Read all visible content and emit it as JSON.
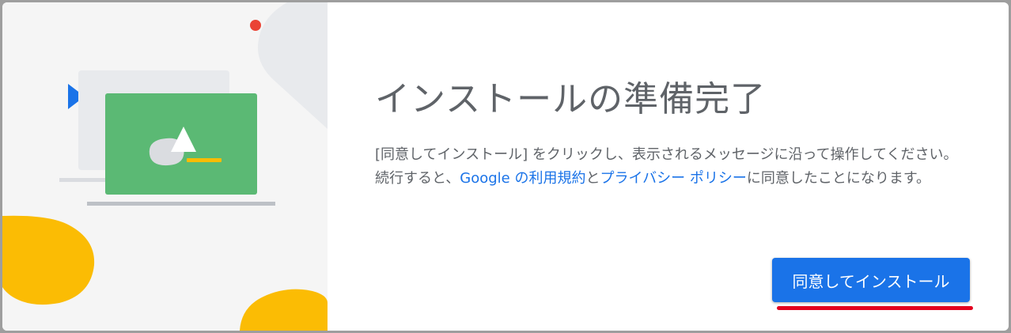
{
  "dialog": {
    "title": "インストールの準備完了",
    "description": {
      "part1": "[同意してインストール] をクリックし、表示されるメッセージに沿って操作してください。続行すると、",
      "link1": "Google の利用規約",
      "part2": "と",
      "link2": "プライバシー ポリシー",
      "part3": "に同意したことになります。"
    },
    "install_button_label": "同意してインストール"
  },
  "colors": {
    "accent": "#1a73e8",
    "illustration_green": "#5bb974",
    "illustration_yellow": "#fbbc04",
    "illustration_blue": "#1a73e8",
    "illustration_red": "#ea4335",
    "annotation_red": "#e4001e"
  }
}
